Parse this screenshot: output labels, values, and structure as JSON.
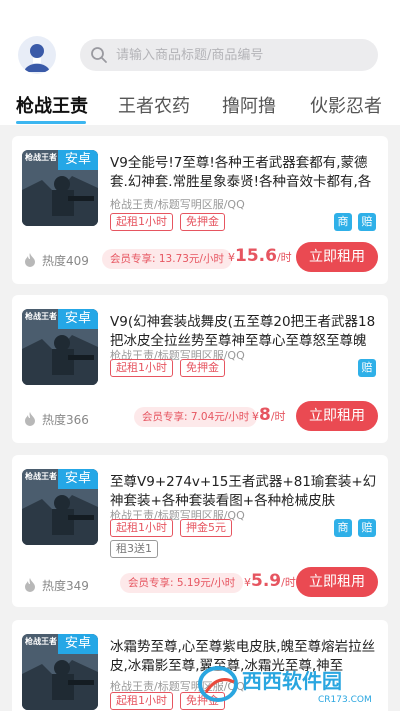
{
  "search": {
    "placeholder": "请输入商品标题/商品编号"
  },
  "tabs": [
    "枪战王责",
    "王者农药",
    "撸阿撸",
    "伙影忍者"
  ],
  "colors": {
    "accent": "#3cb6f0",
    "primary_red": "#ea4a52",
    "badge_blue": "#25a7e6"
  },
  "listings": [
    {
      "badge": "安卓",
      "thumb_logo": "枪战王者",
      "title": "V9全能号!7至尊!各种王者武器套都有,蒙德套.幻神套.常胜星象泰贤!各种音效卡都有,各种...",
      "subtitle": "枪战王责/标题写明区服/QQ",
      "tags": [
        "起租1小时",
        "免押金"
      ],
      "mini_tags": [
        "商",
        "赔"
      ],
      "heat": "热度409",
      "member_price": "会员专享: 13.73元/小时",
      "price_currency": "¥",
      "price": "15.6",
      "price_unit": "/时",
      "rent_label": "立即租用"
    },
    {
      "badge": "安卓",
      "thumb_logo": "枪战王者",
      "title": "V9(幻神套装战舞皮(五至尊20把王者武器18把冰皮全拉丝势至尊神至尊心至尊怒至尊魄至...",
      "subtitle": "枪战王责/标题写明区服/QQ",
      "tags": [
        "起租1小时",
        "免押金"
      ],
      "mini_tags": [
        "赔"
      ],
      "heat": "热度366",
      "member_price": "会员专享: 7.04元/小时",
      "price_currency": "¥",
      "price": "8",
      "price_unit": "/时",
      "rent_label": "立即租用"
    },
    {
      "badge": "安卓",
      "thumb_logo": "枪战王者",
      "title": "至尊V9+274v+15王者武器+81瑜套装+幻神套装+各种套装看图+各种枪械皮肤",
      "subtitle": "枪战王责/标题写明区服/QQ",
      "tags": [
        "起租1小时",
        "押金5元"
      ],
      "extra_tag": "租3送1",
      "mini_tags": [
        "商",
        "赔"
      ],
      "heat": "热度349",
      "member_price": "会员专享: 5.19元/小时",
      "price_currency": "¥",
      "price": "5.9",
      "price_unit": "/时",
      "rent_label": "立即租用"
    },
    {
      "badge": "安卓",
      "thumb_logo": "枪战王者",
      "title": "冰霜势至尊,心至尊紫电皮肤,魄至尊熔岩拉丝皮,冰霜影至尊,翼至尊,冰霜光至尊,神至尊,81...",
      "subtitle": "枪战王责/标题写明区服/QQ",
      "tags": [
        "起租1小时",
        "免押金"
      ],
      "mini_tags": []
    }
  ],
  "watermark": {
    "text": "西西软件园",
    "url": "CR173.COM"
  }
}
